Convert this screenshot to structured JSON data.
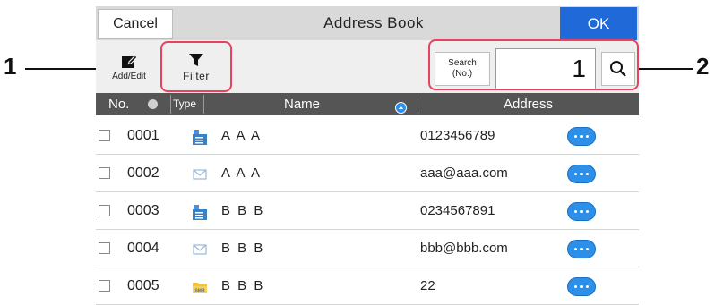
{
  "header": {
    "cancel_label": "Cancel",
    "title": "Address Book",
    "ok_label": "OK"
  },
  "toolbar": {
    "add_edit_label": "Add/Edit",
    "filter_label": "Filter",
    "search_label_line1": "Search",
    "search_label_line2": "(No.)",
    "search_value": "1"
  },
  "columns": {
    "no": "No.",
    "type": "Type",
    "name": "Name",
    "address": "Address"
  },
  "rows": [
    {
      "no": "0001",
      "type": "fax-icon",
      "name": "A A A",
      "address": "0123456789"
    },
    {
      "no": "0002",
      "type": "email-icon",
      "name": "A A A",
      "address": "aaa@aaa.com"
    },
    {
      "no": "0003",
      "type": "fax-icon",
      "name": "B B B",
      "address": "0234567891"
    },
    {
      "no": "0004",
      "type": "email-icon",
      "name": "B B B",
      "address": "bbb@bbb.com"
    },
    {
      "no": "0005",
      "type": "smb-folder-icon",
      "name": "B B B",
      "address": "22"
    }
  ],
  "smb_badge": "SMB",
  "callouts": {
    "one": "1",
    "two": "2"
  },
  "colors": {
    "ok_button": "#1f6ad8",
    "header_bar": "#555555",
    "callout_border": "#e8425e",
    "detail_button": "#2d8fe8"
  }
}
